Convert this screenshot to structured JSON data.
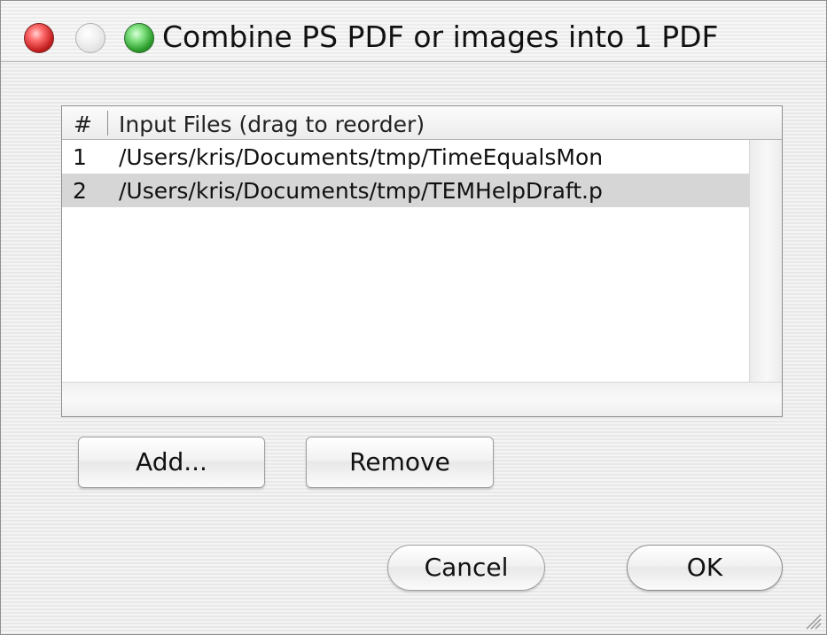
{
  "window": {
    "title": "Combine PS PDF or images into 1 PDF"
  },
  "table": {
    "columns": [
      "#",
      "Input Files (drag to reorder)"
    ],
    "rows": [
      {
        "num": "1",
        "path": "/Users/kris/Documents/tmp/TimeEqualsMon"
      },
      {
        "num": "2",
        "path": "/Users/kris/Documents/tmp/TEMHelpDraft.p"
      }
    ],
    "selected_row": 2
  },
  "buttons": {
    "add": "Add...",
    "remove": "Remove",
    "cancel": "Cancel",
    "ok": "OK"
  },
  "icons": {
    "close": "close-button-icon",
    "minimize": "minimize-button-icon",
    "zoom": "zoom-button-icon",
    "resize": "resize-grip-icon"
  },
  "colors": {
    "selected_row": "#d6d6d6"
  }
}
